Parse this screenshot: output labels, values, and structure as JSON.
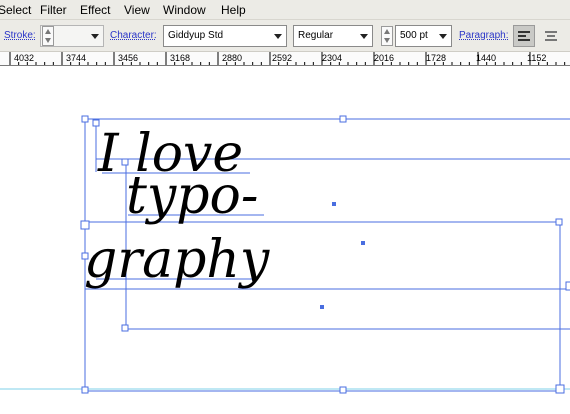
{
  "menu": {
    "items": [
      "Select",
      "Filter",
      "Effect",
      "View",
      "Window",
      "Help"
    ]
  },
  "control_bar": {
    "stroke_label": "Stroke:",
    "stroke_value": "",
    "character_label": "Character:",
    "font_family": "Giddyup Std",
    "font_style": "Regular",
    "font_size": "500 pt",
    "paragraph_label": "Paragraph:"
  },
  "ruler": {
    "labels": [
      "4032",
      "3744",
      "3456",
      "3168",
      "2880",
      "2592",
      "2304",
      "2016",
      "1728",
      "1440",
      "1152"
    ]
  },
  "artwork": {
    "lines": [
      "I love",
      "typo-",
      "graphy"
    ]
  },
  "colors": {
    "selection": "#4a6ee0",
    "guide": "#7fd0e8",
    "label_link": "#2a35c8"
  }
}
